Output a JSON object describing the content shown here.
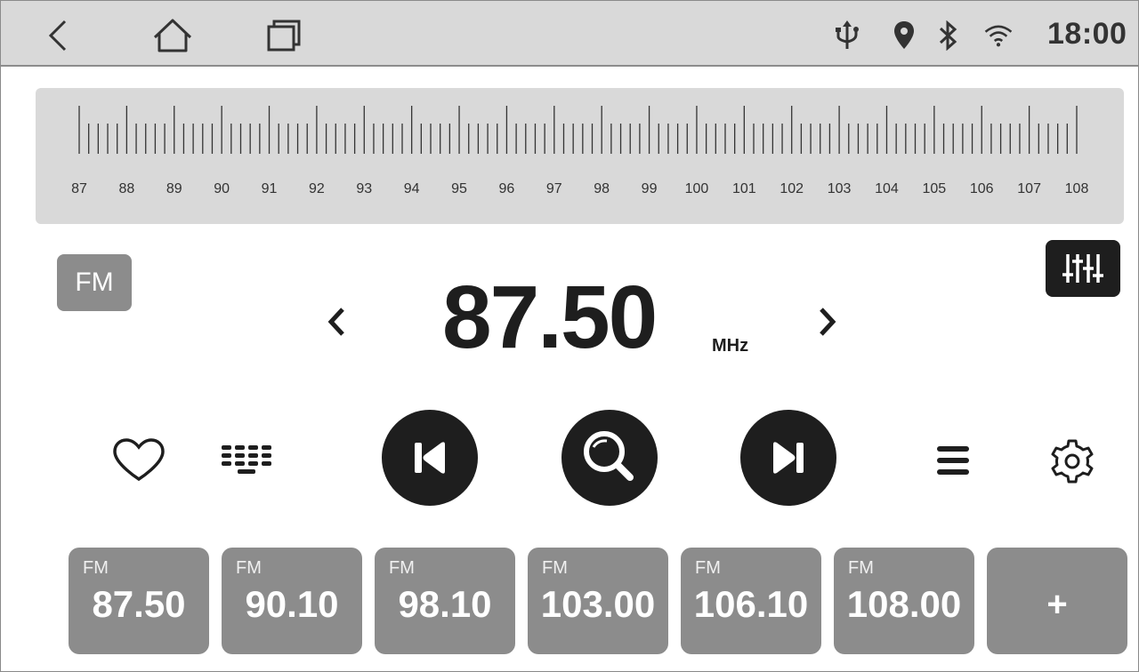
{
  "status_bar": {
    "time": "18:00",
    "icons": [
      "back-icon",
      "home-icon",
      "recent-apps-icon",
      "usb-icon",
      "location-icon",
      "bluetooth-icon",
      "wifi-icon"
    ]
  },
  "scale": {
    "labels": [
      "87",
      "88",
      "89",
      "90",
      "91",
      "92",
      "93",
      "94",
      "95",
      "96",
      "97",
      "98",
      "99",
      "100",
      "101",
      "102",
      "103",
      "104",
      "105",
      "106",
      "107",
      "108"
    ]
  },
  "band": "FM",
  "frequency": "87.50",
  "unit": "MHz",
  "controls": [
    "favorite-icon",
    "keypad-icon",
    "previous-station-icon",
    "search-icon",
    "next-station-icon",
    "menu-icon",
    "settings-icon"
  ],
  "presets": [
    {
      "band": "FM",
      "freq": "87.50"
    },
    {
      "band": "FM",
      "freq": "90.10"
    },
    {
      "band": "FM",
      "freq": "98.10"
    },
    {
      "band": "FM",
      "freq": "103.00"
    },
    {
      "band": "FM",
      "freq": "106.10"
    },
    {
      "band": "FM",
      "freq": "108.00"
    }
  ],
  "add_preset_label": "+",
  "colors": {
    "dark": "#1e1e1e",
    "panel": "#d9d9d9",
    "preset": "#8c8c8c"
  }
}
